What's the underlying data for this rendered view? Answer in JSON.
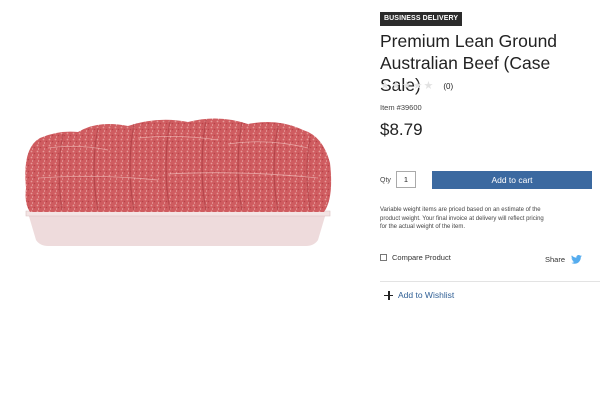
{
  "product": {
    "badge": "BUSINESS DELIVERY",
    "title": "Premium Lean Ground Australian Beef (Case Sale)",
    "rating": {
      "stars_filled": 0,
      "stars_total": 5,
      "count_label": "(0)"
    },
    "item_number": "Item #39600",
    "price": "$8.79",
    "image_icon": "ground-beef-tray-photo"
  },
  "purchase": {
    "qty_label": "Qty",
    "qty_value": "1",
    "add_to_cart_label": "Add to cart",
    "notice": "Variable weight items are priced based on an estimate of the product weight. Your final invoice at delivery will reflect pricing for the actual weight of the item."
  },
  "actions": {
    "compare_label": "Compare Product",
    "share_label": "Share",
    "share_icon": "twitter-bird-icon",
    "wishlist_label": "Add to Wishlist",
    "wishlist_icon": "plus-icon"
  },
  "colors": {
    "badge_bg": "#2b2b2b",
    "button_bg": "#3b69a0",
    "link": "#2f5f95",
    "twitter": "#55acee",
    "empty_star": "#e2e2e2"
  }
}
